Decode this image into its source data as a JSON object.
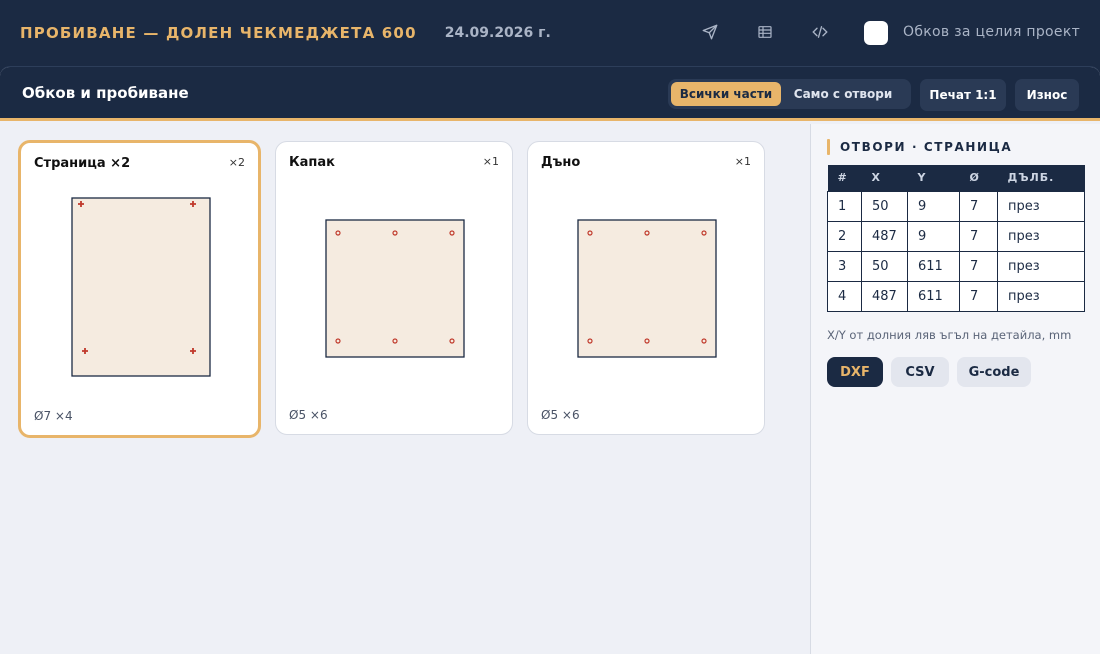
{
  "header": {
    "title": "ПРОБИВАНЕ — ДОЛЕН ЧЕКМЕДЖЕТА 600",
    "date": "24.09.2026 г.",
    "icons": [
      "send-icon",
      "table-icon",
      "code-icon"
    ],
    "whole_project_label": "Обков за целия проект"
  },
  "panel": {
    "title": "Обков и пробиване",
    "filter_all": "Всички части",
    "filter_holes": "Само с отвори",
    "print_button": "Печат 1:1",
    "wear_button": "Износ"
  },
  "parts": [
    {
      "name": "Страница ×2",
      "qty": "×2",
      "footer": "Ø7 ×4",
      "hole_style": "cross"
    },
    {
      "name": "Капак",
      "qty": "×1",
      "footer": "Ø5 ×6",
      "hole_style": "circle"
    },
    {
      "name": "Дъно",
      "qty": "×1",
      "footer": "Ø5 ×6",
      "hole_style": "circle"
    }
  ],
  "holes_panel": {
    "title": "ОТВОРИ · СТРАНИЦА",
    "columns": [
      "#",
      "X",
      "Y",
      "Ø",
      "ДЪЛБ."
    ],
    "rows": [
      [
        "1",
        "50",
        "9",
        "7",
        "през"
      ],
      [
        "2",
        "487",
        "9",
        "7",
        "през"
      ],
      [
        "3",
        "50",
        "611",
        "7",
        "през"
      ],
      [
        "4",
        "487",
        "611",
        "7",
        "през"
      ]
    ],
    "note": "X/Y от долния ляв ъгъл на детайла, mm",
    "export_dxf": "DXF",
    "export_csv": "CSV",
    "export_gcode": "G-code"
  },
  "colors": {
    "navy": "#1b2a43",
    "accent": "#e8b56a",
    "panel_fill": "#f5ebe0",
    "hole": "#c0392b"
  }
}
